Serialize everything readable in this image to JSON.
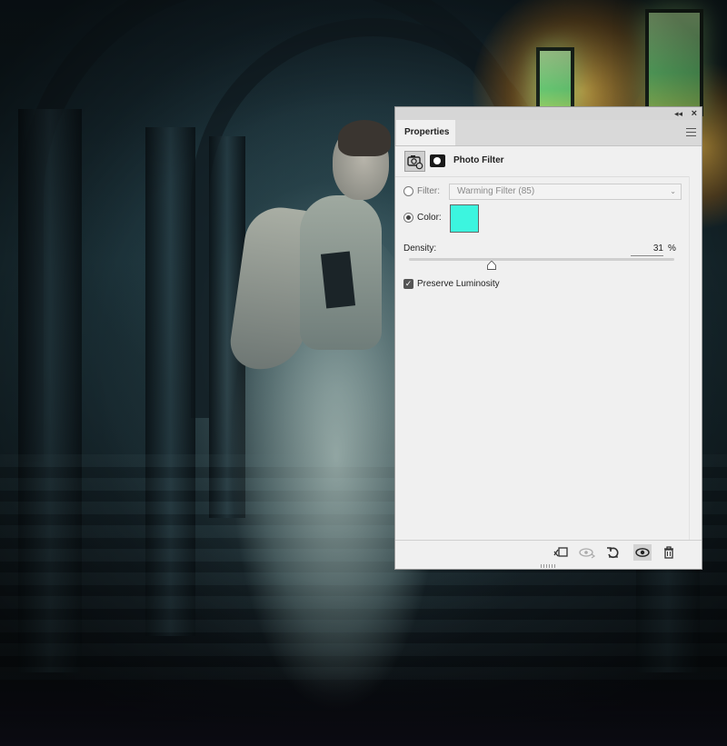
{
  "panel": {
    "collapse_icon": "double-chevron-left-icon",
    "close_icon": "close-icon",
    "tab_label": "Properties",
    "menu_icon": "panel-menu-icon",
    "adjustment_icon": "photo-filter-adjustment-icon",
    "mask_icon": "layer-mask-icon",
    "title": "Photo Filter",
    "filter_label": "Filter:",
    "filter_value": "Warming Filter (85)",
    "filter_selected": false,
    "color_label": "Color:",
    "color_selected": true,
    "color_value": "#3cf5df",
    "density_label": "Density:",
    "density_value": "31",
    "density_unit": "%",
    "density_fraction": 0.31,
    "preserve_label": "Preserve Luminosity",
    "preserve_checked": true,
    "footer_buttons": [
      {
        "icon": "clip-to-layer-icon"
      },
      {
        "icon": "view-previous-state-icon"
      },
      {
        "icon": "reset-icon"
      },
      {
        "icon": "visibility-eye-icon"
      },
      {
        "icon": "trash-icon"
      }
    ]
  }
}
